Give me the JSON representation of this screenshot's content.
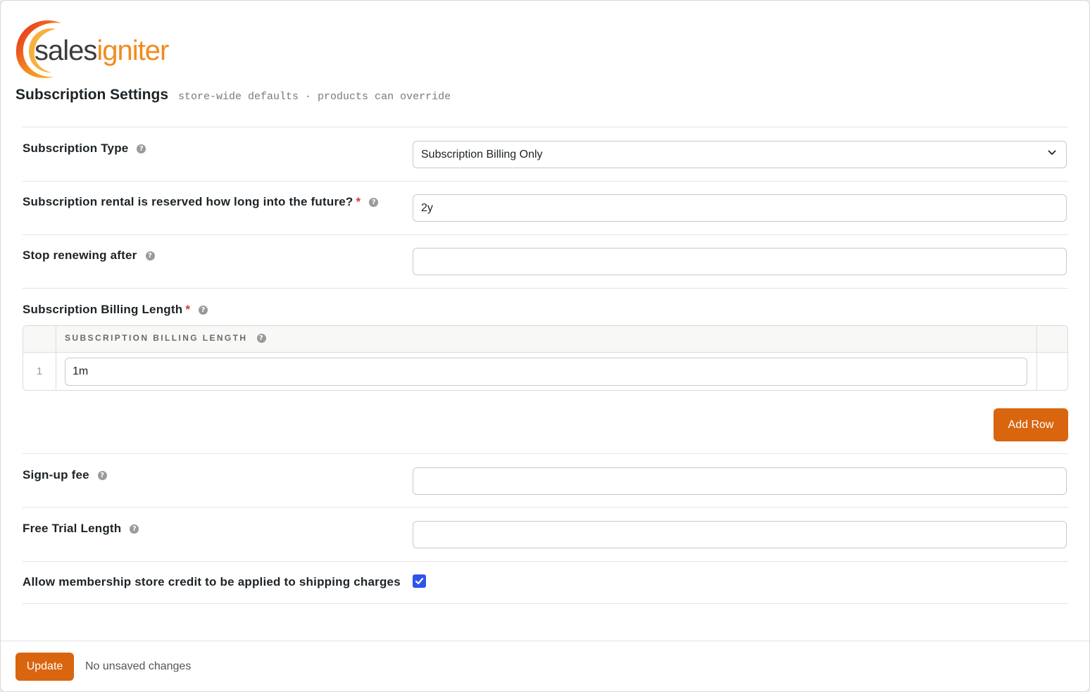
{
  "brand": {
    "name_part1": "sales",
    "name_part2": "igniter"
  },
  "header": {
    "title": "Subscription Settings",
    "subtitle": "store-wide defaults · products can override"
  },
  "fields": {
    "subscription_type": {
      "label": "Subscription Type",
      "value": "Subscription Billing Only"
    },
    "reserved": {
      "label": "Subscription rental is reserved how long into the future?",
      "required": "*",
      "value": "2y"
    },
    "stop_renewing": {
      "label": "Stop renewing after",
      "value": ""
    },
    "billing_length": {
      "label": "Subscription Billing Length",
      "required": "*",
      "column_header": "SUBSCRIPTION BILLING LENGTH",
      "rows": [
        {
          "index": "1",
          "value": "1m"
        }
      ],
      "add_row_label": "Add Row"
    },
    "signup_fee": {
      "label": "Sign-up fee",
      "value": ""
    },
    "free_trial": {
      "label": "Free Trial Length",
      "value": ""
    },
    "shipping_credit": {
      "label": "Allow membership store credit to be applied to shipping charges",
      "checked": true
    }
  },
  "icons": {
    "help": "question-circle-icon",
    "dropdown": "chevron-down-icon",
    "check": "check-icon"
  },
  "colors": {
    "accent": "#d9650f",
    "checkbox": "#2f54eb",
    "required": "#d63638"
  },
  "footer": {
    "update_label": "Update",
    "status": "No unsaved changes"
  }
}
